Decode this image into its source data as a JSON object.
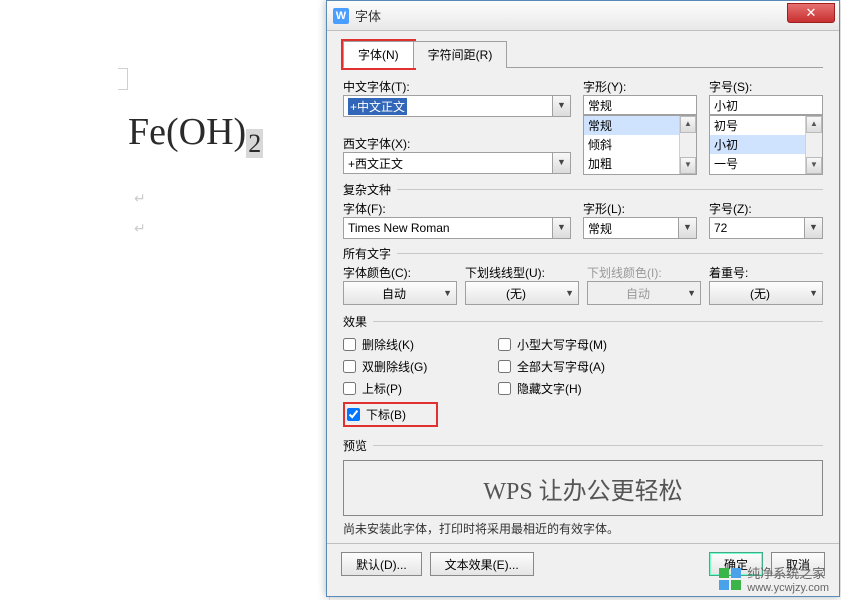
{
  "dialog": {
    "title": "字体",
    "tabs": {
      "font": "字体(N)",
      "spacing": "字符间距(R)"
    },
    "labels": {
      "cjkFont": "中文字体(T):",
      "latinFont": "西文字体(X):",
      "style": "字形(Y):",
      "size": "字号(S):",
      "complexScript": "复杂文种",
      "csFont": "字体(F):",
      "csStyle": "字形(L):",
      "csSize": "字号(Z):",
      "allText": "所有文字",
      "fontColor": "字体颜色(C):",
      "underlineStyle": "下划线线型(U):",
      "underlineColor": "下划线颜色(I):",
      "emphasis": "着重号:",
      "effects": "效果",
      "preview": "预览"
    },
    "values": {
      "cjkFont": "+中文正文",
      "latinFont": "+西文正文",
      "style": "常规",
      "size": "小初",
      "styleList": [
        "常规",
        "倾斜",
        "加粗"
      ],
      "sizeList": [
        "初号",
        "小初",
        "一号"
      ],
      "csFont": "Times New Roman",
      "csStyle": "常规",
      "csSize": "72",
      "fontColor": "自动",
      "underlineStyle": "(无)",
      "underlineColor": "自动",
      "emphasis": "(无)"
    },
    "effects": {
      "strikethrough": "删除线(K)",
      "dblStrike": "双删除线(G)",
      "superscript": "上标(P)",
      "subscript": "下标(B)",
      "smallCaps": "小型大写字母(M)",
      "allCaps": "全部大写字母(A)",
      "hidden": "隐藏文字(H)"
    },
    "previewText": "WPS 让办公更轻松",
    "note": "尚未安装此字体，打印时将采用最相近的有效字体。",
    "buttons": {
      "default": "默认(D)...",
      "textEffects": "文本效果(E)...",
      "ok": "确定",
      "cancel": "取消"
    }
  },
  "doc": {
    "formula_main": "Fe(OH)",
    "formula_sub": "2"
  },
  "watermark": {
    "line1": "纯净系统之家",
    "line2": "www.ycwjzy.com"
  }
}
